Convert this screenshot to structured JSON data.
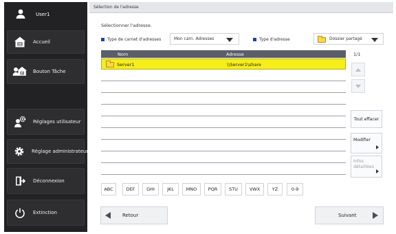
{
  "sidebar": {
    "user": "User1",
    "items": [
      {
        "label": "Accueil",
        "icon": "home-icon"
      },
      {
        "label": "Bouton Tâche",
        "icon": "task-button-icon"
      },
      {
        "label": "Réglages utilisateur",
        "icon": "user-settings-icon"
      },
      {
        "label": "Réglage administrateur",
        "icon": "admin-settings-icon"
      },
      {
        "label": "Déconnexion",
        "icon": "logout-icon"
      },
      {
        "label": "Extinction",
        "icon": "power-icon"
      }
    ]
  },
  "header": {
    "title": "Sélection de l'adresse"
  },
  "main": {
    "instruction": "Sélectionner l'adresse.",
    "book_type_label": "Type de carnet d'adresses",
    "book_type_value": "Mon carn. Adresses",
    "address_type_label": "Type d'adresse",
    "address_type_value": "Dossier partagé"
  },
  "table": {
    "columns": [
      "Nom",
      "Adresse"
    ],
    "rows": [
      {
        "name": "Server1",
        "address": "\\\\Server1\\share",
        "selected": true
      }
    ],
    "page": "1/1"
  },
  "actions": {
    "clear_all": "Tout effacer",
    "modify": "Modifier",
    "details": "Infos détaillées"
  },
  "filters": [
    "ABC",
    "DEF",
    "GHI",
    "JKL",
    "MNO",
    "PQR",
    "STU",
    "VWX",
    "YZ",
    "0-9"
  ],
  "nav": {
    "back": "Retour",
    "next": "Suivant"
  },
  "colors": {
    "accent_blue": "#1f3fb0",
    "selected_row": "#f5ee1a",
    "sidebar_bg": "#222224"
  }
}
